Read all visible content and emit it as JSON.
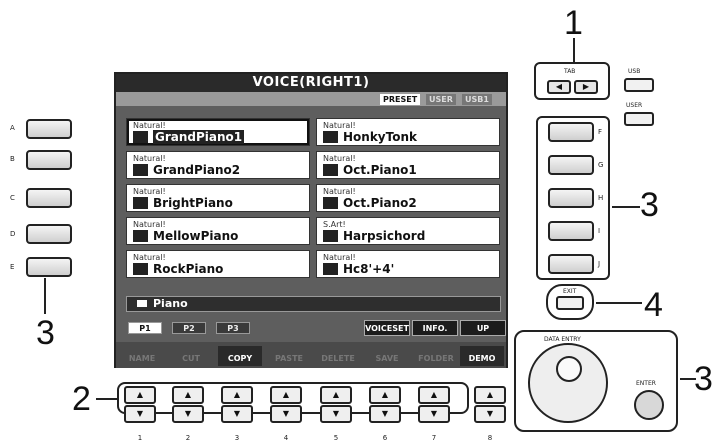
{
  "screen": {
    "title": "VOICE(RIGHT1)",
    "banks": [
      {
        "label": "PRESET",
        "active": true
      },
      {
        "label": "USER",
        "active": false
      },
      {
        "label": "USB1",
        "active": false
      }
    ],
    "voices": [
      {
        "category": "Natural!",
        "name": "GrandPiano1",
        "selected": true
      },
      {
        "category": "Natural!",
        "name": "HonkyTonk",
        "selected": false
      },
      {
        "category": "Natural!",
        "name": "GrandPiano2",
        "selected": false
      },
      {
        "category": "Natural!",
        "name": "Oct.Piano1",
        "selected": false
      },
      {
        "category": "Natural!",
        "name": "BrightPiano",
        "selected": false
      },
      {
        "category": "Natural!",
        "name": "Oct.Piano2",
        "selected": false
      },
      {
        "category": "Natural!",
        "name": "MellowPiano",
        "selected": false
      },
      {
        "category": "S.Art!",
        "name": "Harpsichord",
        "selected": false
      },
      {
        "category": "Natural!",
        "name": "RockPiano",
        "selected": false
      },
      {
        "category": "Natural!",
        "name": "Hc8'+4'",
        "selected": false
      }
    ],
    "folder": "Piano",
    "pages": [
      "P1",
      "P2",
      "P3"
    ],
    "utility": [
      "VOICESET",
      "INFO.",
      "UP"
    ],
    "functions": [
      {
        "label": "NAME",
        "on": false
      },
      {
        "label": "CUT",
        "on": false
      },
      {
        "label": "COPY",
        "on": true
      },
      {
        "label": "PASTE",
        "on": false
      },
      {
        "label": "DELETE",
        "on": false
      },
      {
        "label": "SAVE",
        "on": false
      },
      {
        "label": "FOLDER",
        "on": false
      },
      {
        "label": "DEMO",
        "on": true
      }
    ]
  },
  "left_buttons": [
    "A",
    "B",
    "C",
    "D",
    "E"
  ],
  "right_buttons": [
    "F",
    "G",
    "H",
    "I",
    "J"
  ],
  "panel": {
    "tab_label": "TAB",
    "usb_label": "USB",
    "user_label": "USER",
    "exit_label": "EXIT",
    "data_entry_label": "DATA ENTRY",
    "enter_label": "ENTER"
  },
  "bottom_buttons": [
    "1",
    "2",
    "3",
    "4",
    "5",
    "6",
    "7",
    "8"
  ],
  "callouts": [
    "1",
    "2",
    "3",
    "3",
    "3",
    "4"
  ]
}
